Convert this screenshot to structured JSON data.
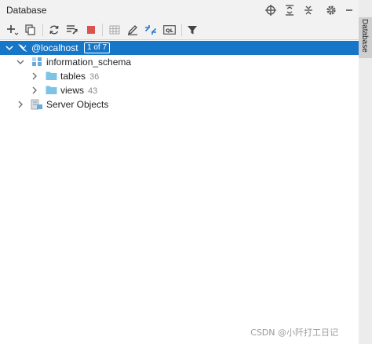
{
  "header": {
    "title": "Database"
  },
  "toolbar": {
    "selected_count": "1 of 7"
  },
  "tree": {
    "root": {
      "label": "@localhost"
    },
    "schema": {
      "label": "information_schema"
    },
    "tables": {
      "label": "tables",
      "count": "36"
    },
    "views": {
      "label": "views",
      "count": "43"
    },
    "server": {
      "label": "Server Objects"
    }
  },
  "side_tab": {
    "label": "Database"
  },
  "watermark": {
    "text": "CSDN @小阡打工日记"
  },
  "colors": {
    "selection": "#1677c8",
    "folder": "#7cc3e6",
    "stop": "#d9534f"
  }
}
